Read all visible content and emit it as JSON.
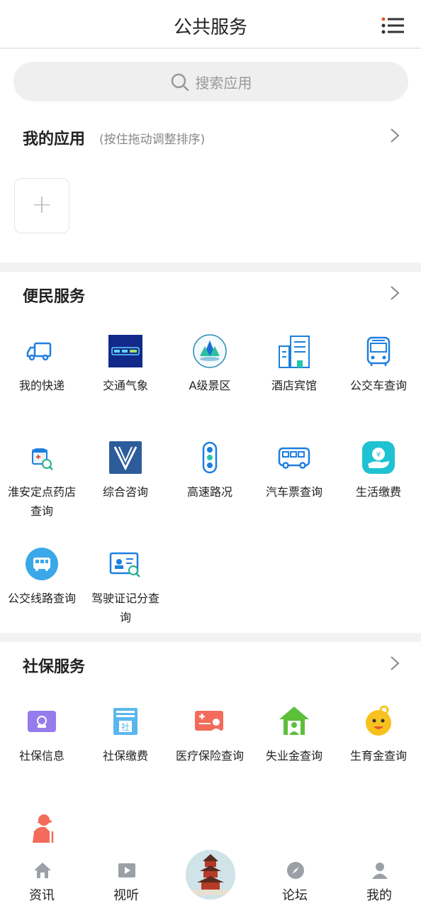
{
  "header": {
    "title": "公共服务",
    "menu_icon": "list-menu-icon"
  },
  "search": {
    "placeholder": "搜索应用"
  },
  "my_apps": {
    "title": "我的应用",
    "hint": "(按住拖动调整排序)",
    "add_symbol": "+"
  },
  "convenience": {
    "title": "便民服务",
    "items": [
      {
        "label": "我的快递",
        "icon": "truck-icon"
      },
      {
        "label": "交通气象",
        "icon": "traffic-weather-icon"
      },
      {
        "label": "A级景区",
        "icon": "scenic-spot-icon"
      },
      {
        "label": "酒店宾馆",
        "icon": "hotel-icon"
      },
      {
        "label": "公交车查询",
        "icon": "bus-icon"
      },
      {
        "label": "淮安定点药店查询",
        "icon": "pharmacy-search-icon"
      },
      {
        "label": "综合咨询",
        "icon": "consult-icon"
      },
      {
        "label": "高速路况",
        "icon": "traffic-light-icon"
      },
      {
        "label": "汽车票查询",
        "icon": "coach-icon"
      },
      {
        "label": "生活缴费",
        "icon": "bill-payment-icon"
      },
      {
        "label": "公交线路查询",
        "icon": "bus-route-icon"
      },
      {
        "label": "驾驶证记分查询",
        "icon": "license-search-icon"
      }
    ]
  },
  "social": {
    "title": "社保服务",
    "items": [
      {
        "label": "社保信息",
        "icon": "social-info-icon"
      },
      {
        "label": "社保缴费",
        "icon": "social-pay-icon"
      },
      {
        "label": "医疗保险查询",
        "icon": "medical-insurance-icon"
      },
      {
        "label": "失业金查询",
        "icon": "unemployment-icon"
      },
      {
        "label": "生育金查询",
        "icon": "maternity-icon"
      },
      {
        "label": "",
        "icon": "elderly-icon"
      }
    ]
  },
  "tabbar": {
    "items": [
      {
        "label": "资讯",
        "icon": "home-icon"
      },
      {
        "label": "视听",
        "icon": "video-icon"
      },
      {
        "label": "",
        "icon": "tower-center-icon"
      },
      {
        "label": "论坛",
        "icon": "compass-icon"
      },
      {
        "label": "我的",
        "icon": "user-icon"
      }
    ]
  },
  "colors": {
    "accent_blue": "#1d7fe0",
    "divider": "#f2f2f2",
    "tab_icon": "#9aa0a6"
  }
}
